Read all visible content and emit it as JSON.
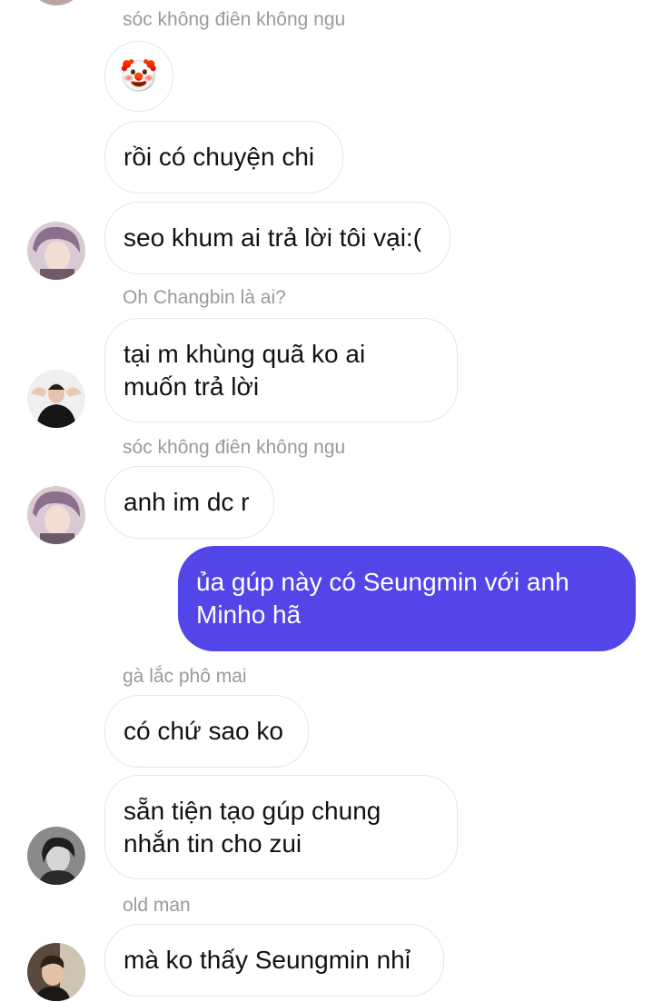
{
  "messages": [
    {
      "sender": "sóc không điên không ngu",
      "lines": []
    },
    {
      "lines": [
        "rồi có chuyện chi"
      ]
    },
    {
      "lines": [
        "seo khum ai trả lời tôi vại:("
      ]
    },
    {
      "sender": "Oh Changbin là ai?",
      "lines": [
        "tại m khùng quã ko ai",
        "muốn trả lời"
      ]
    },
    {
      "sender": "sóc không điên không ngu",
      "lines": [
        "anh im dc r"
      ]
    },
    {
      "outgoing": true,
      "lines": [
        "ủa gúp này có Seungmin với anh",
        "Minho hã"
      ]
    },
    {
      "sender": "gà lắc phô mai",
      "lines": [
        "có chứ sao ko"
      ]
    },
    {
      "lines": [
        "sẵn tiện tạo gúp chung",
        "nhắn tin cho zui"
      ]
    },
    {
      "sender": "old man",
      "lines": [
        "mà ko thấy Seungmin nhỉ"
      ]
    }
  ],
  "emoji": "🤡",
  "colors": {
    "outgoing_bubble": "#5246e8",
    "sender_label": "#9a9a9a"
  }
}
